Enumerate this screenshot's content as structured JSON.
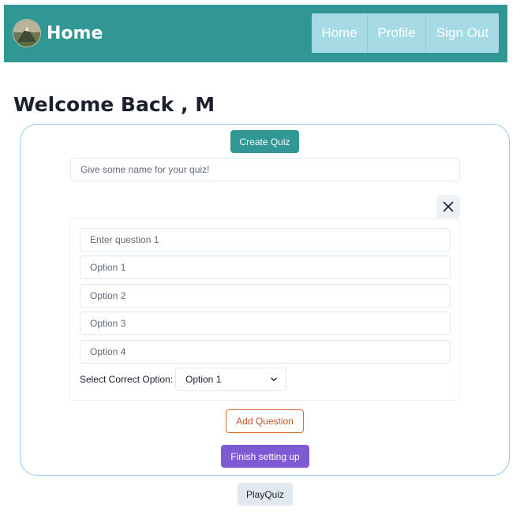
{
  "header": {
    "brand": "Home",
    "nav": [
      {
        "label": "Home"
      },
      {
        "label": "Profile"
      },
      {
        "label": "Sign Out"
      }
    ],
    "colors": {
      "bar": "#319795",
      "nav_group": "#a6dbe6"
    }
  },
  "main": {
    "welcome": "Welcome Back , M",
    "create_quiz_label": "Create Quiz",
    "quiz_name_placeholder": "Give some name for your quiz!",
    "close_icon": "close-icon",
    "question": {
      "question_placeholder": "Enter question 1",
      "option_placeholders": [
        "Option 1",
        "Option 2",
        "Option 3",
        "Option 4"
      ],
      "select_label": "Select Correct Option:",
      "selected_option": "Option 1"
    },
    "add_question_label": "Add Question",
    "finish_label": "Finish setting up"
  },
  "footer": {
    "play_quiz_label": "PlayQuiz"
  },
  "colors": {
    "accent": "#319795",
    "finish": "#805ad5",
    "add_border": "#dd6b20",
    "card_border": "#90cdf4"
  }
}
